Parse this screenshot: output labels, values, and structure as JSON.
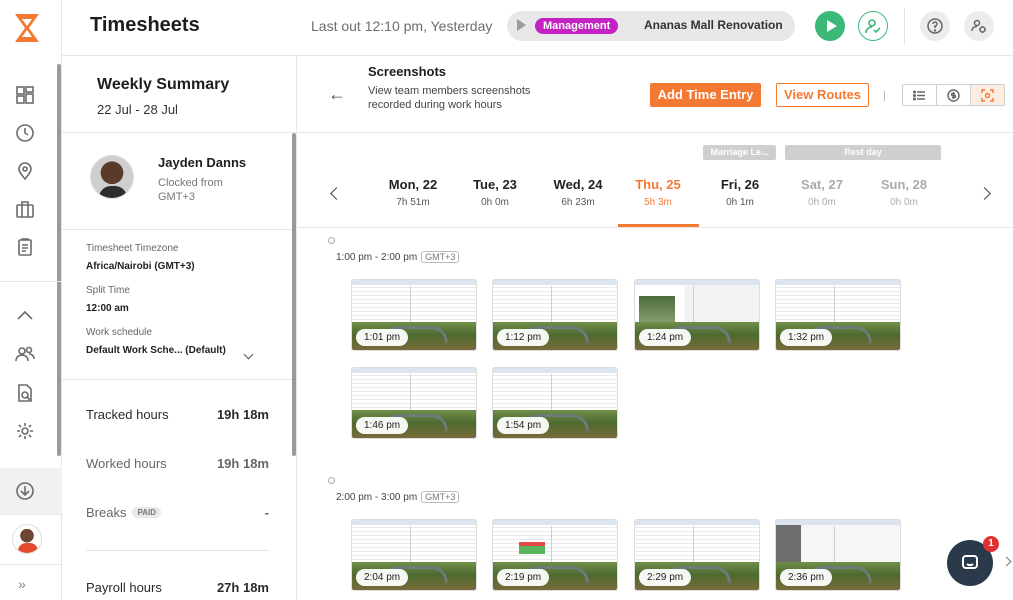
{
  "app": {
    "title": "Timesheets",
    "brand_color": "#f47a33"
  },
  "header": {
    "last_out": "Last out 12:10 pm, Yesterday",
    "job_tag": "Management",
    "project": "Ananas Mall Renovation"
  },
  "rail": {
    "icons": [
      "dashboard-icon",
      "clock-icon",
      "location-icon",
      "briefcase-icon",
      "clipboard-icon",
      "chevron-up-icon",
      "team-icon",
      "reports-icon",
      "settings-icon",
      "download-icon"
    ]
  },
  "summary": {
    "title": "Weekly Summary",
    "date_range": "22 Jul - 28 Jul",
    "member": {
      "name": "Jayden Danns",
      "clocked_from": "Clocked from GMT+3"
    },
    "timezone_label": "Timesheet Timezone",
    "timezone_value": "Africa/Nairobi (GMT+3)",
    "split_label": "Split Time",
    "split_value": "12:00 am",
    "schedule_label": "Work schedule",
    "schedule_value": "Default Work Sche... (Default)",
    "tracked_label": "Tracked hours",
    "tracked_value": "19h 18m",
    "worked_label": "Worked hours",
    "worked_value": "19h 18m",
    "breaks_label": "Breaks",
    "breaks_badge": "PAID",
    "breaks_value": "-",
    "payroll_label": "Payroll hours",
    "payroll_value": "27h 18m"
  },
  "screenshots": {
    "title": "Screenshots",
    "description": "View team members screenshots recorded during work hours",
    "add_button": "Add Time Entry",
    "routes_button": "View Routes"
  },
  "days": [
    {
      "name": "Mon, 22",
      "hours": "7h 51m",
      "state": "normal"
    },
    {
      "name": "Tue, 23",
      "hours": "0h 0m",
      "state": "normal"
    },
    {
      "name": "Wed, 24",
      "hours": "6h 23m",
      "state": "normal"
    },
    {
      "name": "Thu, 25",
      "hours": "5h 3m",
      "state": "active"
    },
    {
      "name": "Fri, 26",
      "hours": "0h 1m",
      "state": "normal"
    },
    {
      "name": "Sat, 27",
      "hours": "0h 0m",
      "state": "future"
    },
    {
      "name": "Sun, 28",
      "hours": "0h 0m",
      "state": "future"
    }
  ],
  "banners": {
    "marriage": "Marriage Le...",
    "rest": "Rest day"
  },
  "slots": [
    {
      "range": "1:00 pm - 2:00 pm",
      "tz": "GMT+3",
      "shots": [
        "1:01 pm",
        "1:12 pm",
        "1:24 pm",
        "1:32 pm",
        "1:46 pm",
        "1:54 pm"
      ]
    },
    {
      "range": "2:00 pm - 3:00 pm",
      "tz": "GMT+3",
      "shots": [
        "2:04 pm",
        "2:19 pm",
        "2:29 pm",
        "2:36 pm"
      ]
    }
  ],
  "chat": {
    "badge": "1"
  }
}
